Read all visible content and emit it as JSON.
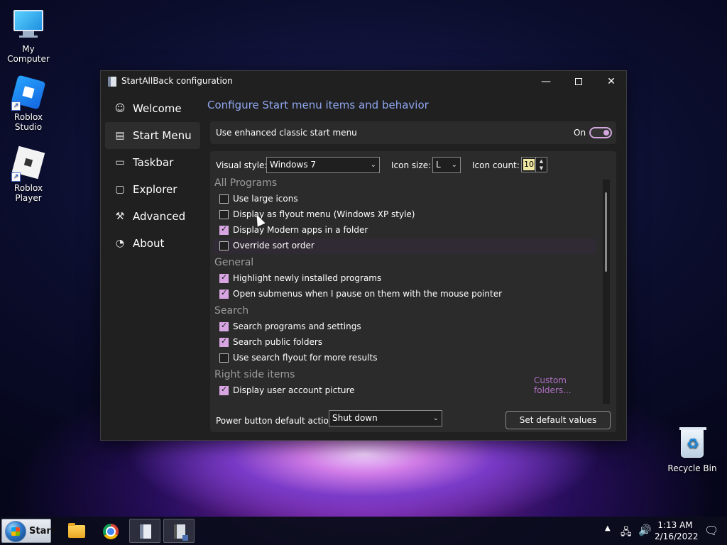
{
  "desktop": {
    "icons": [
      {
        "label": "My Computer"
      },
      {
        "label": "Roblox Studio"
      },
      {
        "label": "Roblox Player"
      },
      {
        "label": "Recycle Bin"
      }
    ]
  },
  "window": {
    "title": "StartAllBack configuration",
    "controls": {
      "minimize": "—",
      "close": "✕"
    }
  },
  "nav": {
    "items": [
      {
        "label": "Welcome",
        "icon": "smile-icon"
      },
      {
        "label": "Start Menu",
        "icon": "start-menu-icon",
        "active": true
      },
      {
        "label": "Taskbar",
        "icon": "taskbar-icon"
      },
      {
        "label": "Explorer",
        "icon": "folder-icon"
      },
      {
        "label": "Advanced",
        "icon": "wrench-icon"
      },
      {
        "label": "About",
        "icon": "gauge-icon"
      }
    ]
  },
  "content": {
    "heading": "Configure Start menu items and behavior",
    "enhanced": {
      "label": "Use enhanced classic start menu",
      "state": "On"
    },
    "visual_style": {
      "label": "Visual style:",
      "value": "Windows 7"
    },
    "icon_size": {
      "label": "Icon size:",
      "value": "L"
    },
    "icon_count": {
      "label": "Icon count:",
      "value": "10"
    },
    "sections": [
      {
        "title": "All Programs",
        "items": [
          {
            "label": "Use large icons",
            "checked": false
          },
          {
            "label": "Display as flyout menu (Windows XP style)",
            "checked": false
          },
          {
            "label": "Display Modern apps in a folder",
            "checked": true
          },
          {
            "label": "Override sort order",
            "checked": false
          }
        ]
      },
      {
        "title": "General",
        "items": [
          {
            "label": "Highlight newly installed programs",
            "checked": true
          },
          {
            "label": "Open submenus when I pause on them with the mouse pointer",
            "checked": true
          }
        ]
      },
      {
        "title": "Search",
        "items": [
          {
            "label": "Search programs and settings",
            "checked": true
          },
          {
            "label": "Search public folders",
            "checked": true
          },
          {
            "label": "Use search flyout for more results",
            "checked": false
          }
        ]
      },
      {
        "title": "Right side items",
        "items": [
          {
            "label": "Display user account picture",
            "checked": true
          }
        ]
      }
    ],
    "custom_folders_link": "Custom folders...",
    "power_button": {
      "label": "Power button default action:",
      "value": "Shut down"
    },
    "set_default": "Set default values"
  },
  "taskbar": {
    "start_label": "Start",
    "clock": {
      "time": "1:13 AM",
      "date": "2/16/2022"
    }
  }
}
